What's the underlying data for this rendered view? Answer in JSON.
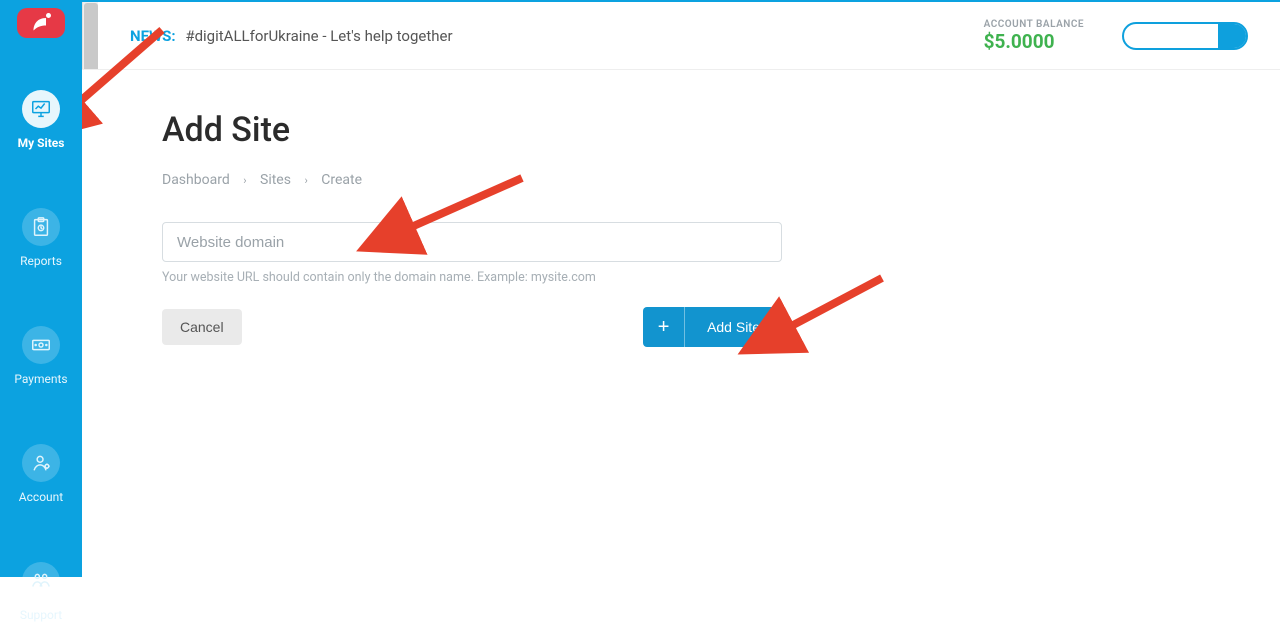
{
  "sidebar": {
    "items": [
      {
        "label": "My Sites"
      },
      {
        "label": "Reports"
      },
      {
        "label": "Payments"
      },
      {
        "label": "Account"
      },
      {
        "label": "Support"
      }
    ]
  },
  "topbar": {
    "news_label": "NEWS:",
    "news_text": "#digitALLforUkraine - Let's help together",
    "balance_label": "ACCOUNT BALANCE",
    "balance_value": "$5.0000"
  },
  "page": {
    "title": "Add Site",
    "breadcrumbs": {
      "dashboard": "Dashboard",
      "sites": "Sites",
      "create": "Create",
      "sep": "›"
    },
    "form": {
      "domain_placeholder": "Website domain",
      "domain_value": "",
      "hint": "Your website URL should contain only the domain name. Example: mysite.com"
    },
    "buttons": {
      "cancel": "Cancel",
      "add_site": "Add Site"
    }
  }
}
